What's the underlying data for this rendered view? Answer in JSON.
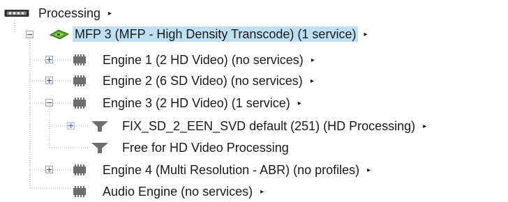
{
  "tree": {
    "root": {
      "label": "Processing",
      "icon": "processing-card-icon"
    },
    "mfp": {
      "label": "MFP 3 (MFP - High Density Transcode) (1 service)",
      "icon": "mfp-board-icon",
      "selected": true
    },
    "engines": [
      {
        "label": "Engine 1 (2 HD Video) (no services)",
        "icon": "engine-chip-icon",
        "state": "collapsed"
      },
      {
        "label": "Engine 2 (6 SD Video) (no services)",
        "icon": "engine-chip-icon",
        "state": "collapsed"
      },
      {
        "label": "Engine 3 (2 HD Video) (1 service)",
        "icon": "engine-chip-icon",
        "state": "expanded"
      },
      {
        "label": "Engine 4 (Multi Resolution - ABR) (no profiles)",
        "icon": "engine-chip-icon",
        "state": "collapsed"
      },
      {
        "label": "Audio Engine (no services)",
        "icon": "engine-chip-icon",
        "state": "leaf"
      }
    ],
    "services": [
      {
        "label": "FIX_SD_2_EEN_SVD default (251) (HD Processing)",
        "icon": "filter-funnel-icon",
        "state": "collapsed",
        "has_menu": true
      },
      {
        "label": "Free for HD Video Processing",
        "icon": "filter-funnel-icon",
        "state": "leaf",
        "has_menu": false
      }
    ],
    "menu_glyph": "▸",
    "expand_glyph": "+",
    "collapse_glyph": "−"
  },
  "colors": {
    "selection": "#bfe0f2",
    "tree_line": "#9aa3ad",
    "chip": "#6e6e6e",
    "board_green": "#5aa02c",
    "expand_blue": "#2a4fb8"
  }
}
